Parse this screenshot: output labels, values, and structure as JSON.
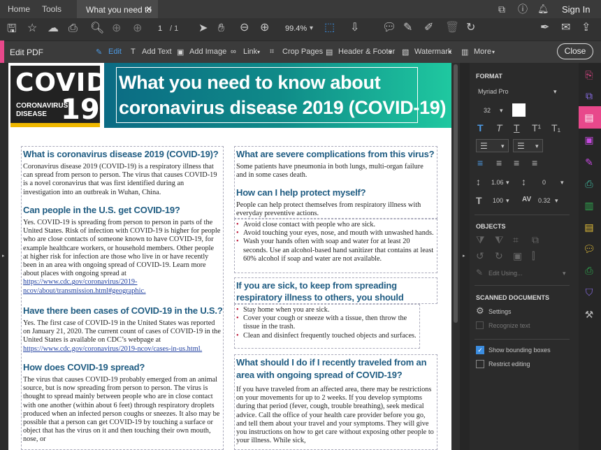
{
  "menubar": {
    "home": "Home",
    "tools": "Tools",
    "tab_title": "What you need to ...",
    "sign_in": "Sign In"
  },
  "toolbar": {
    "page_current": "1",
    "page_total": "/ 1",
    "zoom": "99.4%"
  },
  "edit_bar": {
    "label": "Edit PDF",
    "edit": "Edit",
    "add_text": "Add Text",
    "add_image": "Add Image",
    "link": "Link",
    "crop": "Crop Pages",
    "header_footer": "Header & Footer",
    "watermark": "Watermark",
    "more": "More",
    "close": "Close"
  },
  "panel": {
    "format": "FORMAT",
    "font": "Myriad Pro",
    "size": "32",
    "line_spacing": "1.06",
    "para_spacing": "0",
    "scale": "100",
    "char_spacing": "0.32",
    "objects": "OBJECTS",
    "edit_using": "Edit Using...",
    "scanned": "SCANNED DOCUMENTS",
    "settings": "Settings",
    "recognize": "Recognize text",
    "show_bb": "Show bounding boxes",
    "restrict": "Restrict editing"
  },
  "doc": {
    "logo_line1": "COVID",
    "logo_line2": "CORONAVIRUS",
    "logo_line3": "DISEASE",
    "logo_num": "19",
    "title_l1": "What you need to know about",
    "title_l2": "coronavirus disease 2019 (COVID-19)",
    "h1": "What is coronavirus disease 2019 (COVID-19)?",
    "p1": "Coronavirus disease 2019 (COVID-19) is a respiratory illness that can spread from person to person. The virus that causes COVID-19 is a novel coronavirus that was first identified during an investigation into an outbreak in Wuhan, China.",
    "h2": "Can people in the U.S. get COVID-19?",
    "p2": "Yes. COVID-19 is spreading from person to person in parts of the United States. Risk of infection with COVID-19 is higher for people who are close contacts of someone known to have COVID-19, for example healthcare workers, or household members. Other people at higher risk for infection are those who live in or have recently been in an area with ongoing spread of COVID-19. Learn more about places with ongoing spread at",
    "p2_link": "https://www.cdc.gov/coronavirus/2019-ncov/about/transmission.html#geographic.",
    "h3": "Have there been cases of COVID-19 in the U.S.?",
    "p3": "Yes. The first case of COVID-19 in the United States was reported on January 21, 2020. The current count of cases of COVID-19 in the United States is available on CDC’s webpage at",
    "p3_link": "https://www.cdc.gov/coronavirus/2019-ncov/cases-in-us.html.",
    "h4": "How does COVID-19 spread?",
    "p4": "The virus that causes COVID-19 probably emerged from an animal source, but is now spreading from person to person. The virus is thought to spread mainly between people who are in close contact with one another (within about 6 feet) through respiratory droplets produced when an infected person coughs or sneezes. It also may be possible that a person can get COVID-19 by touching a surface or object that has the virus on it and then touching their own mouth, nose, or",
    "h5": "What are severe complications from this virus?",
    "p5": "Some patients have pneumonia in both lungs, multi-organ failure and in some cases death.",
    "h6": "How can I help protect myself?",
    "p6": "People can help protect themselves from respiratory illness with everyday preventive actions.",
    "list1": [
      "Avoid close contact with people who are sick.",
      "Avoid touching your eyes, nose, and mouth with unwashed hands.",
      "Wash your hands often with soap and water for at least 20 seconds. Use an alcohol-based hand sanitizer that contains at least 60% alcohol if soap and water are not available."
    ],
    "h7": "If you are sick, to keep from spreading respiratory illness to others, you should",
    "list2": [
      "Stay home when you are sick.",
      "Cover your cough or sneeze with a tissue, then throw the tissue in the trash.",
      "Clean and disinfect frequently touched objects and surfaces."
    ],
    "h8": "What should I do if I recently traveled from an area with ongoing spread of COVID-19?",
    "p8": "If you have traveled from an affected area, there may be restrictions on your movements for up to 2 weeks. If you develop symptoms during that period (fever, cough, trouble breathing), seek medical advice. Call the office of your health care provider before you go, and tell them about your travel and your symptoms. They will give you instructions on how to get care without exposing other people to your illness. While sick,"
  }
}
